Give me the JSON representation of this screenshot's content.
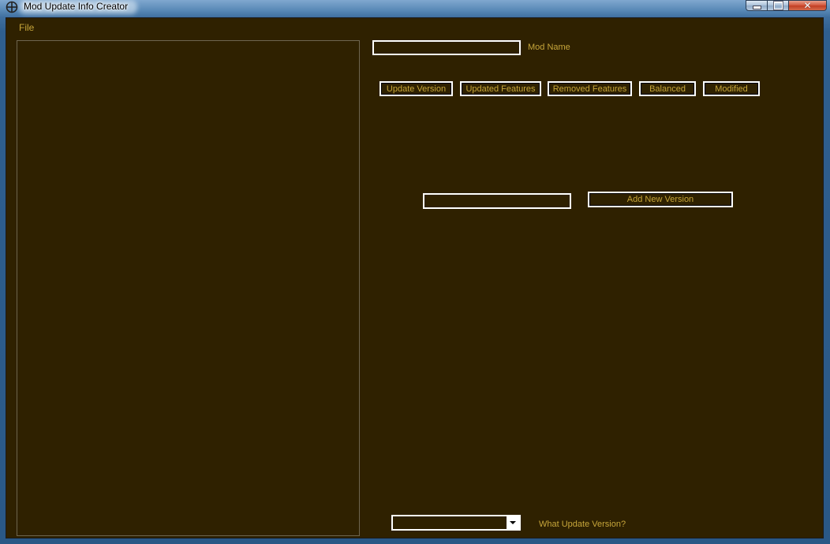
{
  "window": {
    "title": "Mod Update Info Creator",
    "icon": "crosshair-circle-icon"
  },
  "menu": {
    "file_label": "File"
  },
  "mod_name": {
    "value": "",
    "label": "Mod Name"
  },
  "tabs": [
    {
      "label": "Update Version"
    },
    {
      "label": "Updated Features"
    },
    {
      "label": "Removed Features"
    },
    {
      "label": "Balanced"
    },
    {
      "label": "Modified"
    }
  ],
  "new_version": {
    "value": "",
    "button_label": "Add New Version"
  },
  "update_version_select": {
    "selected": "",
    "label": "What Update Version?"
  },
  "colors": {
    "client_background": "#2f2100",
    "text_gold": "#c7a63a",
    "control_border": "#ffffff"
  }
}
